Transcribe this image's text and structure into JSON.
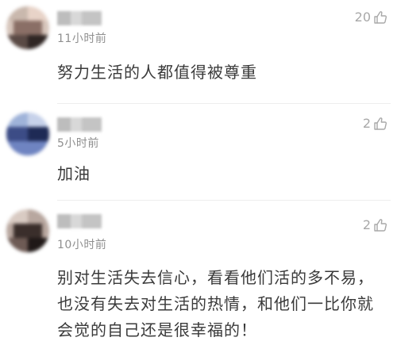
{
  "comments": [
    {
      "time": "11小时前",
      "likes": "20",
      "text": "努力生活的人都值得被尊重",
      "avatar_colors": [
        "#c9b8ad",
        "#5a4a45",
        "#e8d3c8",
        "#8a6f66",
        "#2f2624"
      ]
    },
    {
      "time": "5小时前",
      "likes": "2",
      "text": "加油",
      "avatar_colors": [
        "#9fb3d9",
        "#1e2a55",
        "#6f84c1",
        "#3c4c86",
        "#c7d2ea"
      ]
    },
    {
      "time": "10小时前",
      "likes": "2",
      "text": "别对生活失去信心，看看他们活的多不易，也没有失去对生活的热情，和他们一比你就会觉的自己还是很幸福的！",
      "avatar_colors": [
        "#b8a79f",
        "#3a2e2b",
        "#d9cbc3",
        "#6e5b55",
        "#1f1817"
      ]
    }
  ],
  "colors": {
    "text": "#3a3a3a",
    "meta": "#8f8f8f",
    "like": "#a8a8a8",
    "divider": "#eeeeee"
  },
  "icons": {
    "like": "thumbs-up-outline-icon"
  }
}
